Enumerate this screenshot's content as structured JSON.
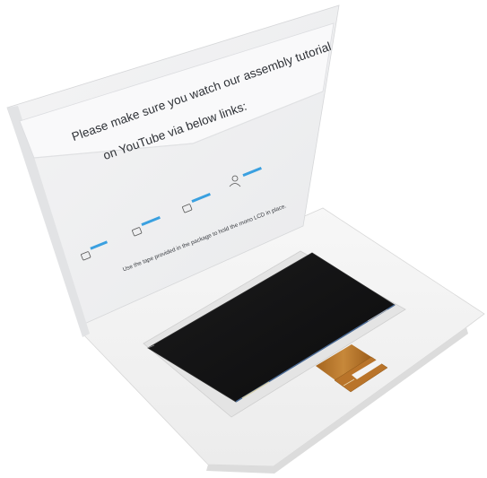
{
  "packaging": {
    "title_line_1": "Please make sure you watch our assembly tutorial",
    "title_line_2": "on YouTube via below links:",
    "tape_note": "Use the tape provided in the package to hold the mono LCD in place.",
    "link_cards": [
      {
        "icon": "monitor-icon"
      },
      {
        "icon": "monitor-icon"
      },
      {
        "icon": "monitor-icon"
      },
      {
        "icon": "user-icon"
      }
    ]
  },
  "colors": {
    "box_white": "#f6f6f6",
    "screen_black": "#141414",
    "ribbon_amber": "#b9742a",
    "link_blue": "#3aa0e0"
  }
}
